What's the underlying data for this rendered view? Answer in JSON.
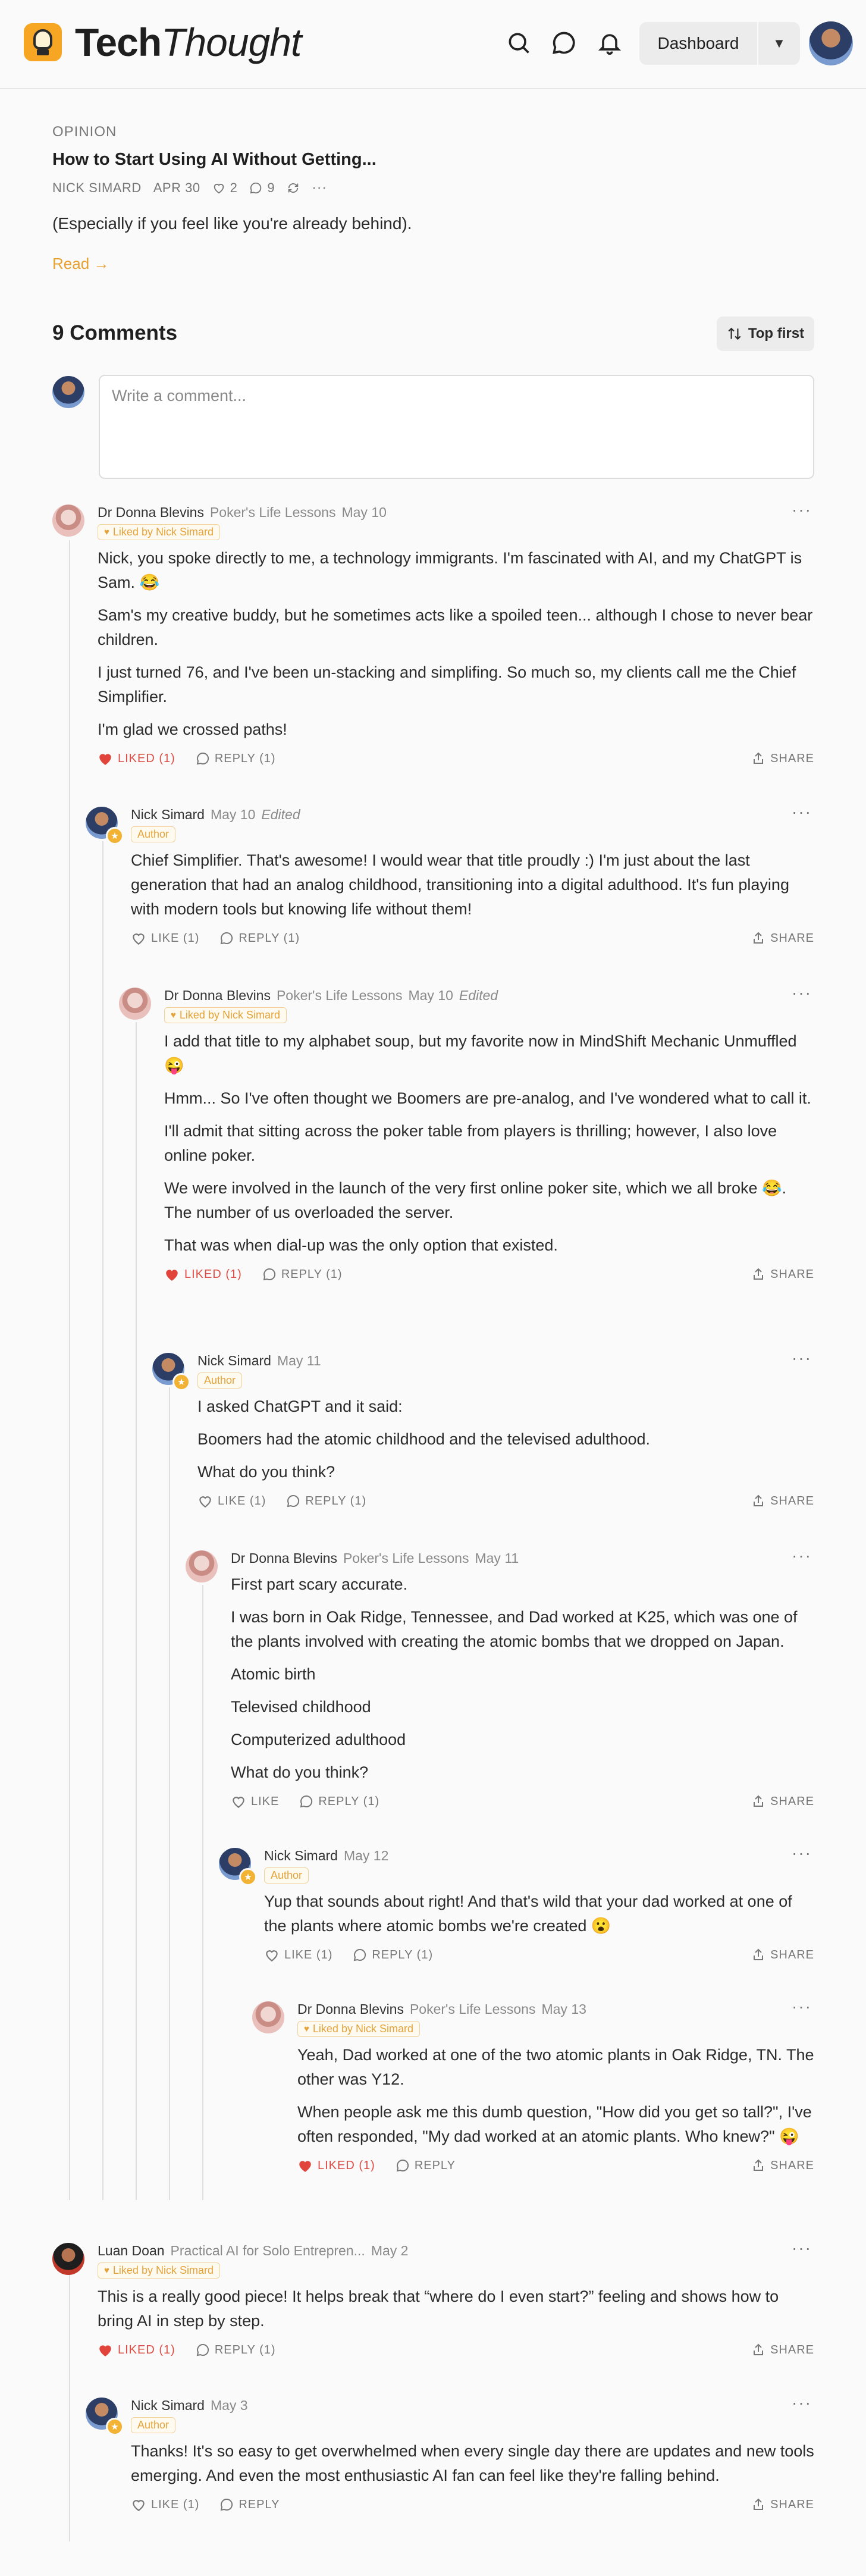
{
  "brand": {
    "name_bold": "Tech",
    "name_italic": "Thought",
    "accent": "#f6a623"
  },
  "header": {
    "dashboard_label": "Dashboard"
  },
  "post": {
    "kicker": "OPINION",
    "title": "How to Start Using AI Without Getting...",
    "author": "NICK SIMARD",
    "date": "APR 30",
    "likes": "2",
    "comments": "9",
    "subtitle": "(Especially if you feel like you're already behind).",
    "read_label": "Read →"
  },
  "comments_section": {
    "title": "9 Comments",
    "sort_label": "Top first",
    "compose_placeholder": "Write a comment..."
  },
  "comments": [
    {
      "name": "Dr Donna Blevins",
      "pub": "Poker's Life Lessons",
      "date": "May 10",
      "edited": "",
      "tag": "Liked by Nick Simard",
      "body": [
        "Nick, you spoke directly to me, a technology immigrants. I'm fascinated with AI, and my ChatGPT is Sam. 😂",
        "Sam's my creative buddy, but he sometimes acts like a spoiled teen... although I chose to never bear children.",
        "I just turned 76, and I've been un-stacking and simplifing. So much so, my clients call me the Chief Simplifier.",
        "I'm glad we crossed paths!"
      ],
      "like": "LIKED (1)",
      "reply": "REPLY (1)",
      "share": "SHARE"
    },
    {
      "name": "Nick Simard",
      "pub": "",
      "date": "May 10",
      "edited": "Edited",
      "tag": "Author",
      "body": [
        "Chief Simplifier. That's awesome! I would wear that title proudly :) I'm just about the last generation that had an analog childhood, transitioning into a digital adulthood. It's fun playing with modern tools but knowing life without them!"
      ],
      "like": "LIKE (1)",
      "reply": "REPLY (1)",
      "share": "SHARE"
    },
    {
      "name": "Dr Donna Blevins",
      "pub": "Poker's Life Lessons",
      "date": "May 10",
      "edited": "Edited",
      "tag": "Liked by Nick Simard",
      "body": [
        "I add that title to my alphabet soup, but my favorite now in MindShift Mechanic Unmuffled 😜",
        "Hmm... So I've often thought we Boomers are pre-analog, and I've wondered what to call it.",
        "I'll admit that sitting across the poker table from players is thrilling; however, I also love online poker.",
        "We were involved in the launch of the very first online poker site, which we all broke 😂. The number of us overloaded the server.",
        "That was when dial-up was the only option that existed."
      ],
      "like": "LIKED (1)",
      "reply": "REPLY (1)",
      "share": "SHARE"
    },
    {
      "name": "Nick Simard",
      "pub": "",
      "date": "May 11",
      "edited": "",
      "tag": "Author",
      "body": [
        "I asked ChatGPT and it said:",
        "Boomers had the atomic childhood and the televised adulthood.",
        "What do you think?"
      ],
      "like": "LIKE (1)",
      "reply": "REPLY (1)",
      "share": "SHARE"
    },
    {
      "name": "Dr Donna Blevins",
      "pub": "Poker's Life Lessons",
      "date": "May 11",
      "edited": "",
      "tag": "",
      "body": [
        "First part scary accurate.",
        "I was born in Oak Ridge, Tennessee, and Dad worked at K25, which was one of the plants involved with creating the atomic bombs that we dropped on Japan.",
        "Atomic birth",
        "Televised childhood",
        "Computerized adulthood",
        "What do you think?"
      ],
      "like": "LIKE",
      "reply": "REPLY (1)",
      "share": "SHARE"
    },
    {
      "name": "Nick Simard",
      "pub": "",
      "date": "May 12",
      "edited": "",
      "tag": "Author",
      "body": [
        "Yup that sounds about right! And that's wild that your dad worked at one of the plants where atomic bombs we're created 😮"
      ],
      "like": "LIKE (1)",
      "reply": "REPLY (1)",
      "share": "SHARE"
    },
    {
      "name": "Dr Donna Blevins",
      "pub": "Poker's Life Lessons",
      "date": "May 13",
      "edited": "",
      "tag": "Liked by Nick Simard",
      "body": [
        "Yeah, Dad worked at one of the two atomic plants in Oak Ridge, TN. The other was Y12.",
        "When people ask me this dumb question, \"How did you get so tall?\", I've often responded, \"My dad worked at an atomic plants. Who knew?\" 😜"
      ],
      "like": "LIKED (1)",
      "reply": "REPLY",
      "share": "SHARE"
    },
    {
      "name": "Luan Doan",
      "pub": "Practical AI for Solo Entrepren...",
      "date": "May 2",
      "edited": "",
      "tag": "Liked by Nick Simard",
      "body": [
        "This is a really good piece! It helps break that “where do I even start?” feeling and shows how to bring AI in step by step."
      ],
      "like": "LIKED (1)",
      "reply": "REPLY (1)",
      "share": "SHARE"
    },
    {
      "name": "Nick Simard",
      "pub": "",
      "date": "May 3",
      "edited": "",
      "tag": "Author",
      "body": [
        "Thanks! It's so easy to get overwhelmed when every single day there are updates and new tools emerging. And even the most enthusiastic AI fan can feel like they're falling behind."
      ],
      "like": "LIKE (1)",
      "reply": "REPLY",
      "share": "SHARE"
    }
  ]
}
